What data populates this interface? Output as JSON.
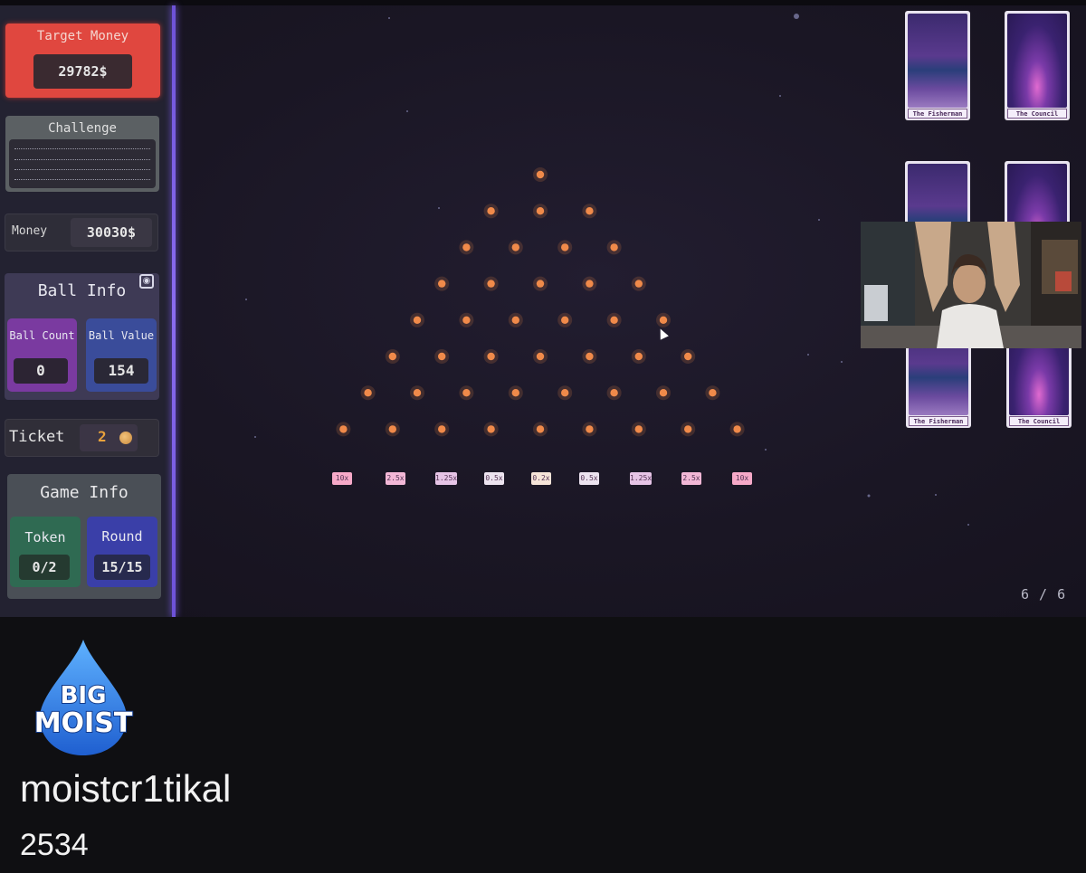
{
  "hud": {
    "target_money": {
      "label": "Target Money",
      "value": "29782$"
    },
    "challenge": {
      "label": "Challenge"
    },
    "money": {
      "label": "Money",
      "value": "30030$"
    },
    "ball_info": {
      "label": "Ball Info",
      "ball_count": {
        "label": "Ball Count",
        "value": "0"
      },
      "ball_value": {
        "label": "Ball Value",
        "value": "154"
      }
    },
    "ticket": {
      "label": "Ticket",
      "value": "2"
    },
    "game_info": {
      "label": "Game Info",
      "token": {
        "label": "Token",
        "value": "0/2"
      },
      "round": {
        "label": "Round",
        "value": "15/15"
      }
    }
  },
  "board": {
    "multipliers": [
      "10x",
      "2.5x",
      "1.25x",
      "0.5x",
      "0.2x",
      "0.5x",
      "1.25x",
      "2.5x",
      "10x"
    ],
    "multiplier_colors": [
      "#f6a9c8",
      "#f2b7d6",
      "#e6c4e6",
      "#ece3ef",
      "#f6e4d8",
      "#ece3ef",
      "#e6c4e6",
      "#f2b7d6",
      "#f6a9c8"
    ],
    "page_indicator": "6 / 6",
    "peg_color": "#f08a4a"
  },
  "cards": [
    {
      "label": "The Fisherman",
      "art": "fisher"
    },
    {
      "label": "The Council",
      "art": "council"
    },
    {
      "label": "",
      "art": "fisher"
    },
    {
      "label": "",
      "art": "council"
    },
    {
      "label": "The Fisherman",
      "art": "fisher"
    },
    {
      "label": "The Council",
      "art": "council"
    }
  ],
  "channel": {
    "logo_text_top": "BIG",
    "logo_text_bottom": "MOIST",
    "name": "moistcr1tikal",
    "count": "2534"
  }
}
